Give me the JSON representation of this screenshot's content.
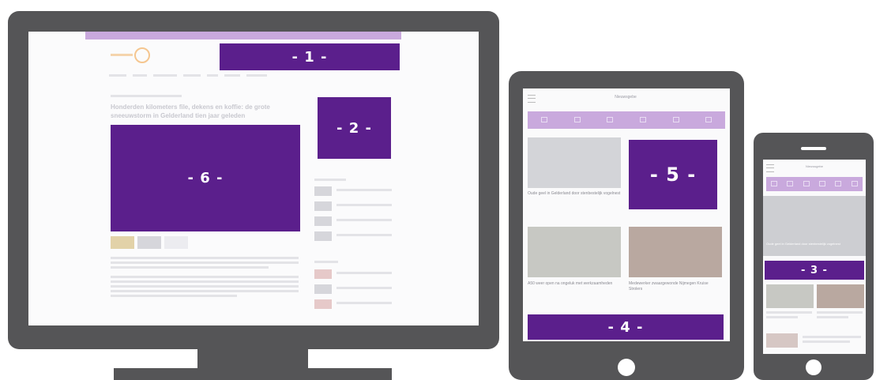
{
  "labels": {
    "slot1": "- 1 -",
    "slot2": "- 2 -",
    "slot3": "- 3 -",
    "slot4": "- 4 -",
    "slot5": "- 5 -",
    "slot6": "- 6 -"
  },
  "desktop": {
    "headline": "Honderden kilometers file, dekens en koffie: de grote sneeuwstorm in Gelderland tien jaar geleden"
  },
  "tablet": {
    "app_title": "Nieuwsgebe",
    "card1_caption": "Oude geel in Gelderland door stenbestelijk vogelnest",
    "card2_caption": "A50 weer open na ongeluk met werkzaamheden",
    "card3_caption": "Medewerker zwaargewonde Nijmegen Kruise Strolers"
  },
  "phone": {
    "app_title": "Nieuwsgebe",
    "hero_caption": "Oude geel in Gelderland door stenbestelijk vogelnest"
  },
  "colors": {
    "ad_slot": "#5b1f8c",
    "bezel": "#555557",
    "nav_bar": "#c9a9dd"
  }
}
